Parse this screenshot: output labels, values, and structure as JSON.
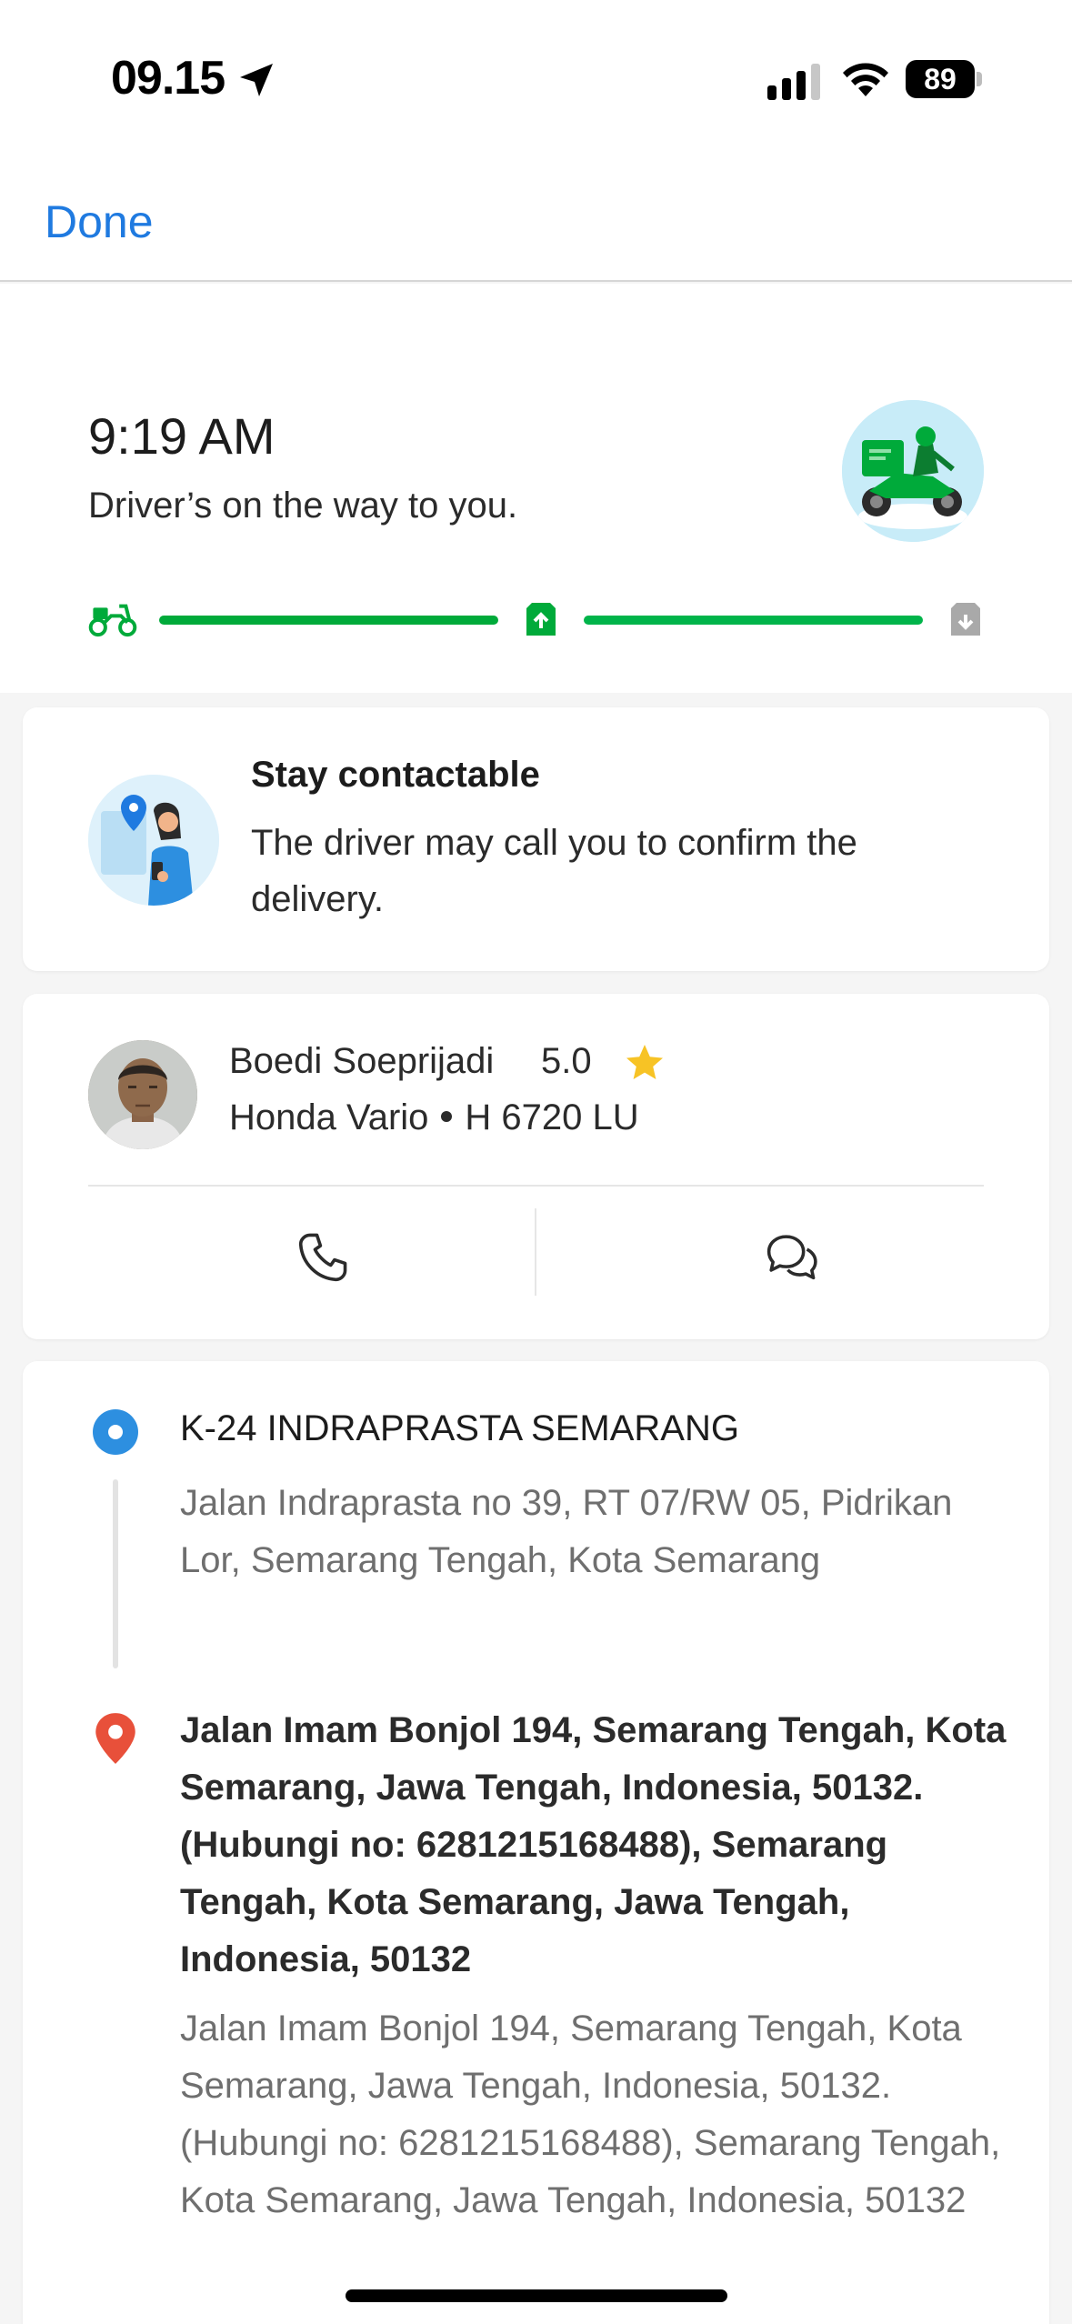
{
  "status_bar": {
    "time": "09.15",
    "battery": "89"
  },
  "nav": {
    "done_label": "Done"
  },
  "order_status": {
    "eta_time": "9:19 AM",
    "message": "Driver’s on the way to you.",
    "progress": {
      "steps": [
        "driver-assigned",
        "picked-up",
        "delivered"
      ],
      "segment_1_fraction": 1.0,
      "segment_2_fraction": 1.0,
      "accent_color": "#00aa3a"
    }
  },
  "contact_card": {
    "title": "Stay contactable",
    "description": "The driver may call you to confirm the delivery."
  },
  "driver": {
    "name": "Boedi Soeprijadi",
    "rating": "5.0",
    "vehicle_model": "Honda Vario",
    "plate": "H 6720 LU"
  },
  "route": {
    "pickup": {
      "name": "K-24 INDRAPRASTA SEMARANG",
      "address": "Jalan Indraprasta no 39, RT 07/RW 05, Pidrikan Lor, Semarang Tengah, Kota Semarang"
    },
    "dropoff": {
      "name": "Jalan Imam Bonjol 194, Semarang Tengah, Kota Semarang, Jawa Tengah, Indonesia, 50132. (Hubungi no: 6281215168488), Semarang Tengah, Kota Semarang, Jawa Tengah, Indonesia, 50132",
      "address": "Jalan Imam Bonjol 194, Semarang Tengah, Kota Semarang, Jawa Tengah, Indonesia, 50132. (Hubungi no: 6281215168488), Semarang Tengah, Kota Semarang, Jawa Tengah, Indonesia, 50132"
    }
  }
}
